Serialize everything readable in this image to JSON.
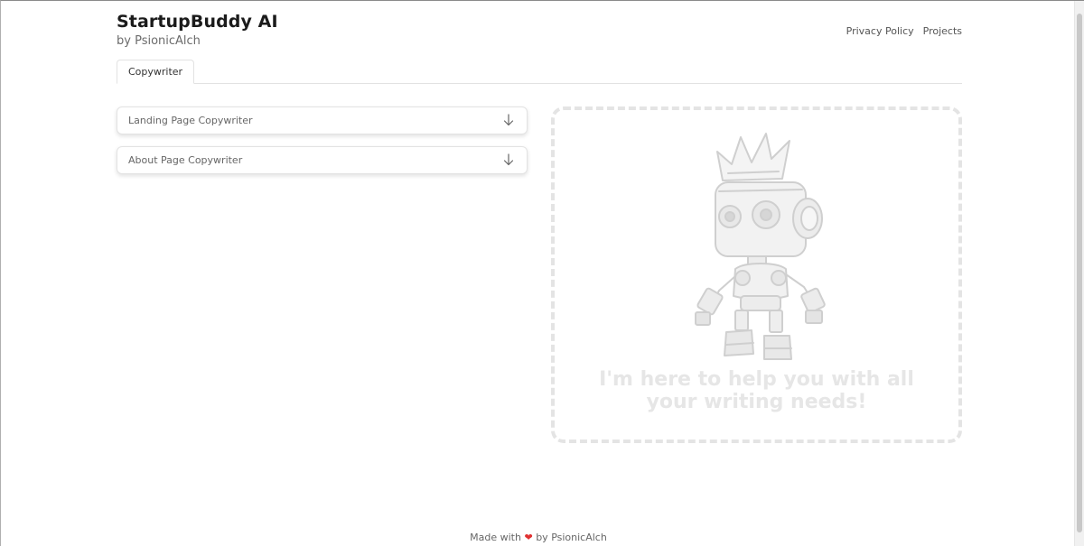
{
  "header": {
    "title": "StartupBuddy AI",
    "subtitle": "by PsionicAlch",
    "nav": {
      "privacy": "Privacy Policy",
      "projects": "Projects"
    }
  },
  "tabs": [
    {
      "label": "Copywriter",
      "active": true
    }
  ],
  "accordions": [
    {
      "label": "Landing Page Copywriter",
      "icon": "arrow-down-icon"
    },
    {
      "label": "About Page Copywriter",
      "icon": "arrow-down-icon"
    }
  ],
  "output_panel": {
    "illustration": "robot-illustration",
    "placeholder": "I'm here to help you with all your writing needs!"
  },
  "footer": {
    "made_with": "Made with",
    "heart": "❤",
    "by": "by PsionicAlch"
  },
  "colors": {
    "heart": "#e03131",
    "dashed_border": "#e4e4e4",
    "placeholder_text": "#e6e6e6"
  }
}
